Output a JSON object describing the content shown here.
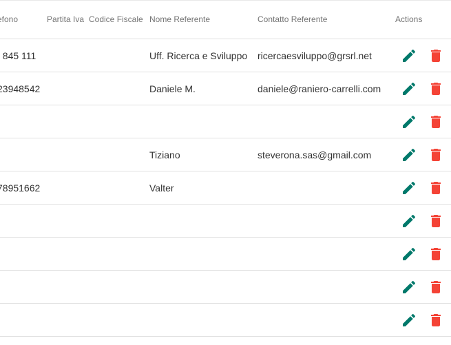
{
  "table": {
    "headers": {
      "telefono": "efono",
      "partita_iva": "Partita Iva",
      "codice_fiscale": "Codice Fiscale",
      "nome_referente": "Nome Referente",
      "contatto_referente": "Contatto Referente",
      "actions": "Actions"
    },
    "rows": [
      {
        "telefono": "I 845 111",
        "nome_referente": "Uff. Ricerca e Sviluppo",
        "contatto_referente": "ricercaesviluppo@grsrl.net"
      },
      {
        "telefono": "23948542",
        "nome_referente": "Daniele M.",
        "contatto_referente": "daniele@raniero-carrelli.com"
      },
      {
        "telefono": "",
        "nome_referente": "",
        "contatto_referente": ""
      },
      {
        "telefono": "",
        "nome_referente": "Tiziano",
        "contatto_referente": "steverona.sas@gmail.com"
      },
      {
        "telefono": "78951662",
        "nome_referente": "Valter",
        "contatto_referente": ""
      },
      {
        "telefono": "",
        "nome_referente": "",
        "contatto_referente": ""
      },
      {
        "telefono": "",
        "nome_referente": "",
        "contatto_referente": ""
      },
      {
        "telefono": "",
        "nome_referente": "",
        "contatto_referente": ""
      },
      {
        "telefono": "",
        "nome_referente": "",
        "contatto_referente": ""
      }
    ]
  },
  "icons": {
    "edit": "pencil-icon",
    "delete": "trash-icon"
  },
  "colors": {
    "edit": "#00796b",
    "delete": "#f44336",
    "header_text": "#757575",
    "divider": "#e0e0e0"
  }
}
